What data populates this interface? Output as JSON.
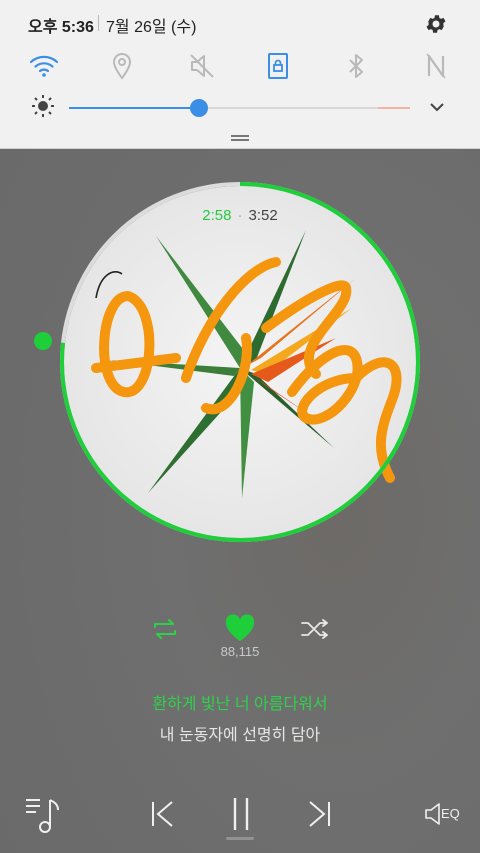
{
  "status_bar": {
    "time": "오후 5:36",
    "date": "7월 26일 (수)"
  },
  "quick_settings": [
    {
      "name": "wifi",
      "active": true
    },
    {
      "name": "location",
      "active": false
    },
    {
      "name": "sound-mute",
      "active": false
    },
    {
      "name": "screen-rotation-lock",
      "active": true
    },
    {
      "name": "bluetooth",
      "active": false
    },
    {
      "name": "nfc",
      "active": false
    }
  ],
  "brightness": {
    "level": 0.38
  },
  "player": {
    "time_current": "2:58",
    "time_total": "3:52",
    "like_count": "88,115",
    "lyric_current": "환하게 빛난 너 아름다워서",
    "lyric_next": "내 눈동자에 선명히 담아",
    "eq_label": "EQ",
    "progress": 0.767
  },
  "colors": {
    "accent_green": "#2ed24a",
    "slider_blue": "#3a8ee6",
    "annotation_orange": "#f5960f"
  }
}
